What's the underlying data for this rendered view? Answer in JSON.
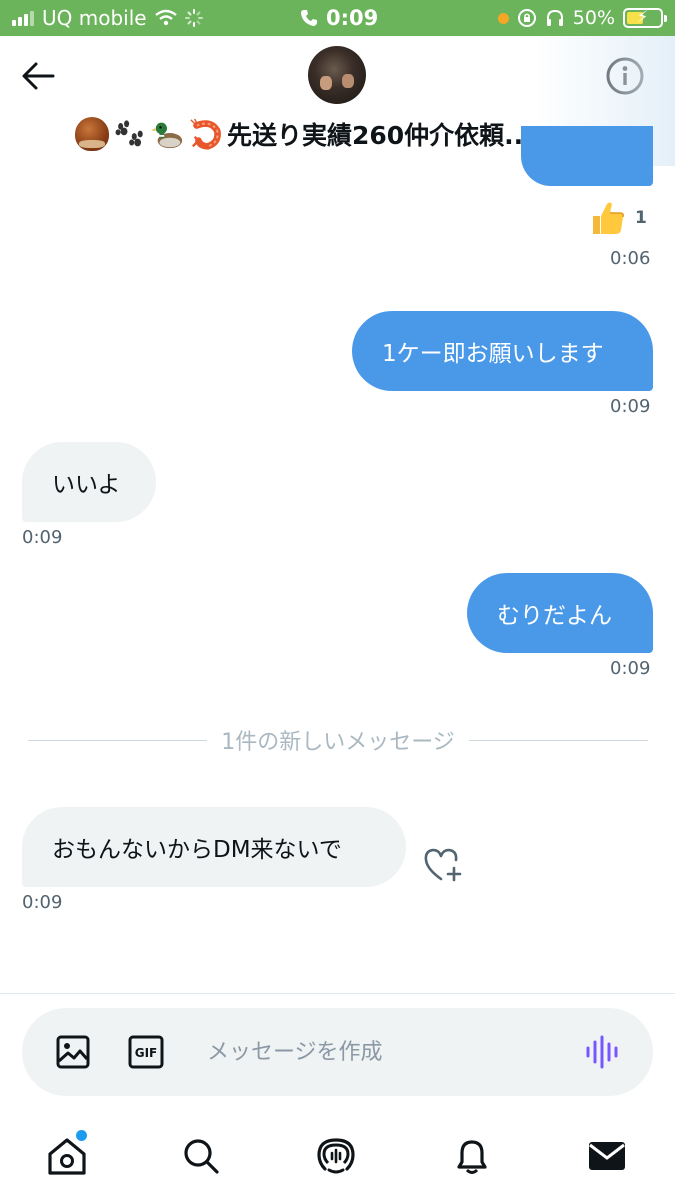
{
  "status_bar": {
    "carrier": "UQ mobile",
    "time": "0:09",
    "battery": "50%",
    "battery_level": 0.5
  },
  "header": {
    "title": "先送り実績260仲介依頼..."
  },
  "messages": [
    {
      "reaction_count": "1",
      "time": "0:06"
    },
    {
      "text": "1ケー即お願いします",
      "time": "0:09"
    },
    {
      "text": "いいよ",
      "time": "0:09"
    },
    {
      "text": "むりだよん",
      "time": "0:09"
    },
    {
      "text": "おもんないからDM来ないで",
      "time": "0:09"
    }
  ],
  "divider": {
    "label": "1件の新しいメッセージ"
  },
  "composer": {
    "gif_label": "GIF",
    "placeholder": "メッセージを作成"
  },
  "colors": {
    "status_bar": "#6cb45c",
    "sent_bubble": "#4a99e9",
    "received_bubble": "#eff3f4",
    "accent": "#1d9bf0",
    "voice_icon": "#7856ff"
  },
  "icons": {
    "back": "back-arrow-icon",
    "info": "info-icon",
    "image": "image-icon",
    "gif": "gif-icon",
    "voice": "voice-icon",
    "home": "home-icon",
    "search": "search-icon",
    "spaces": "spaces-icon",
    "notifications": "bell-icon",
    "messages": "mail-icon",
    "like": "heart-plus-icon"
  }
}
